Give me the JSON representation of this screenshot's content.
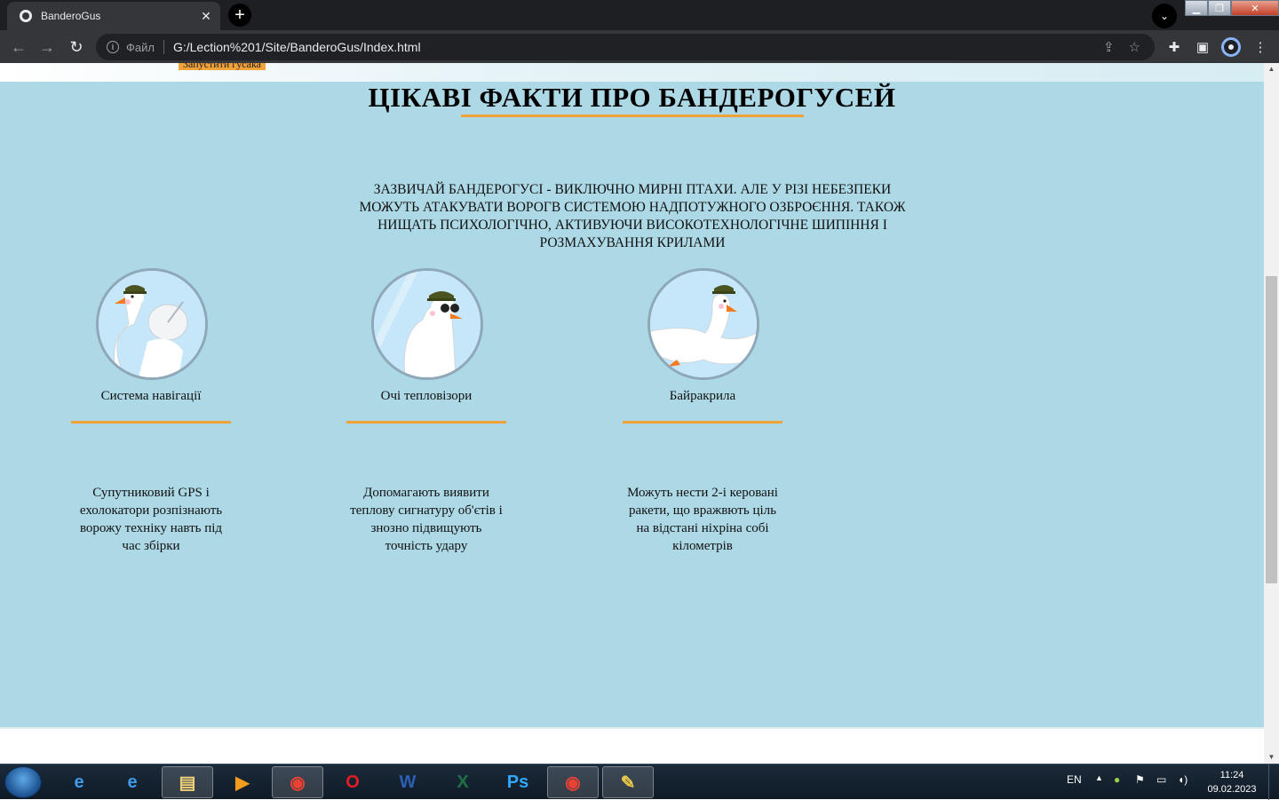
{
  "browser": {
    "tab_title": "BanderoGus",
    "tab_close": "✕",
    "new_tab": "+",
    "address_scheme": "Файл",
    "address_url": "G:/Lection%201/Site/BanderoGus/Index.html"
  },
  "page": {
    "launch_button": "Запустити гусака",
    "facts_title": "ЦІКАВІ ФАКТИ ПРО БАНДЕРОГУСЕЙ",
    "facts_intro": "ЗАЗВИЧАЙ БАНДЕРОГУСІ - ВИКЛЮЧНО МИРНІ ПТАХИ. АЛЕ У РІЗІ НЕБЕЗПЕКИ МОЖУТЬ АТАКУВАТИ ВОРОГВ СИСТЕМОЮ НАДПОТУЖНОГО ОЗБРОЄННЯ. ТАКОЖ НИЩАТЬ ПСИХОЛОГІЧНО, АКТИВУЮЧИ ВИСОКОТЕХНОЛОГІЧНЕ ШИПІННЯ І РОЗМАХУВАННЯ КРИЛАМИ",
    "cards": [
      {
        "title": "Система навігації",
        "text": "Супутниковий GPS і ехолокатори розпізнають ворожу техніку навть під час збірки",
        "icon": "goose-satellite-dish-icon"
      },
      {
        "title": "Очі тепловізори",
        "text": "Допомагають виявити теплову сигнатуру об'єтів і знозно підвищують точність удару",
        "icon": "goose-binoculars-icon"
      },
      {
        "title": "Байракрила",
        "text": "Можуть нести 2-і керовані ракети, що вражвють ціль на відстані ніхріна собі кілометрів",
        "icon": "goose-wings-icon"
      }
    ]
  },
  "taskbar": {
    "language": "EN",
    "time": "11:24",
    "date": "09.02.2023"
  },
  "colors": {
    "section_bg": "#add8e6",
    "accent": "#f2a23a"
  }
}
